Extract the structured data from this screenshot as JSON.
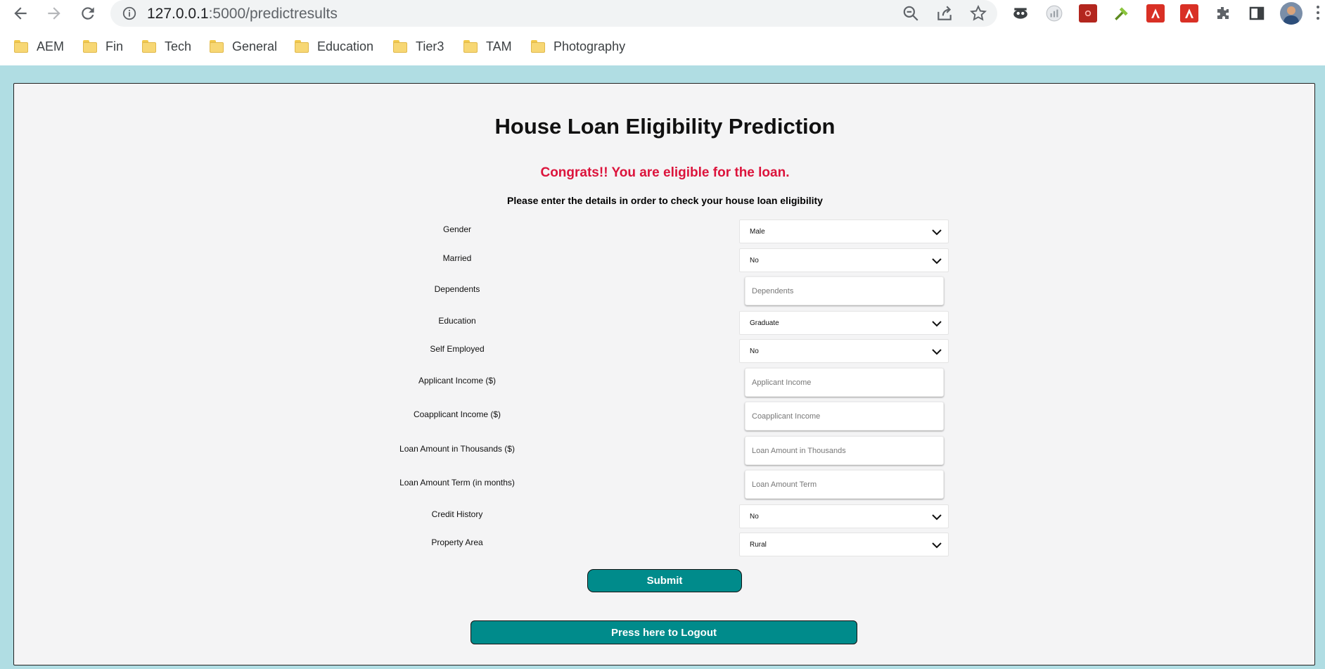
{
  "browser": {
    "url_host": "127.0.0.1",
    "url_path": ":5000/predictresults",
    "bookmarks": [
      "AEM",
      "Fin",
      "Tech",
      "General",
      "Education",
      "Tier3",
      "TAM",
      "Photography"
    ]
  },
  "page": {
    "title": "House Loan Eligibility Prediction",
    "result": "Congrats!! You are eligible for the loan.",
    "instructions": "Please enter the details in order to check your house loan eligibility",
    "colors": {
      "background": "#b0dde3",
      "panel": "#f4f4f5",
      "result": "#dc143c",
      "button": "#008b8b"
    }
  },
  "form": {
    "gender": {
      "label": "Gender",
      "value": "Male"
    },
    "married": {
      "label": "Married",
      "value": "No"
    },
    "dependents": {
      "label": "Dependents",
      "placeholder": "Dependents"
    },
    "education": {
      "label": "Education",
      "value": "Graduate"
    },
    "self_employed": {
      "label": "Self Employed",
      "value": "No"
    },
    "applicant_income": {
      "label": "Applicant Income ($)",
      "placeholder": "Applicant Income"
    },
    "coapplicant_income": {
      "label": "Coapplicant Income ($)",
      "placeholder": "Coapplicant Income"
    },
    "loan_amount": {
      "label": "Loan Amount in Thousands ($)",
      "placeholder": "Loan Amount in Thousands"
    },
    "loan_term": {
      "label": "Loan Amount Term (in months)",
      "placeholder": "Loan Amount Term"
    },
    "credit_history": {
      "label": "Credit History",
      "value": "No"
    },
    "property_area": {
      "label": "Property Area",
      "value": "Rural"
    },
    "submit_label": "Submit",
    "logout_label": "Press here to Logout"
  }
}
